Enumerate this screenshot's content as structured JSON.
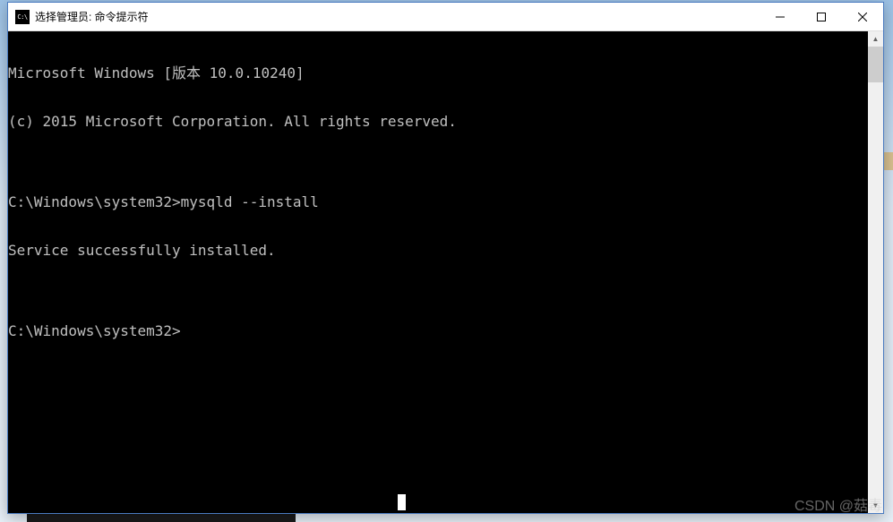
{
  "window": {
    "title": "选择管理员: 命令提示符",
    "icon_label": "C:\\"
  },
  "console": {
    "lines": [
      "Microsoft Windows [版本 10.0.10240]",
      "(c) 2015 Microsoft Corporation. All rights reserved.",
      "",
      "C:\\Windows\\system32>mysqld --install",
      "Service successfully installed.",
      "",
      "C:\\Windows\\system32>"
    ]
  },
  "watermark": "CSDN @菇毒"
}
